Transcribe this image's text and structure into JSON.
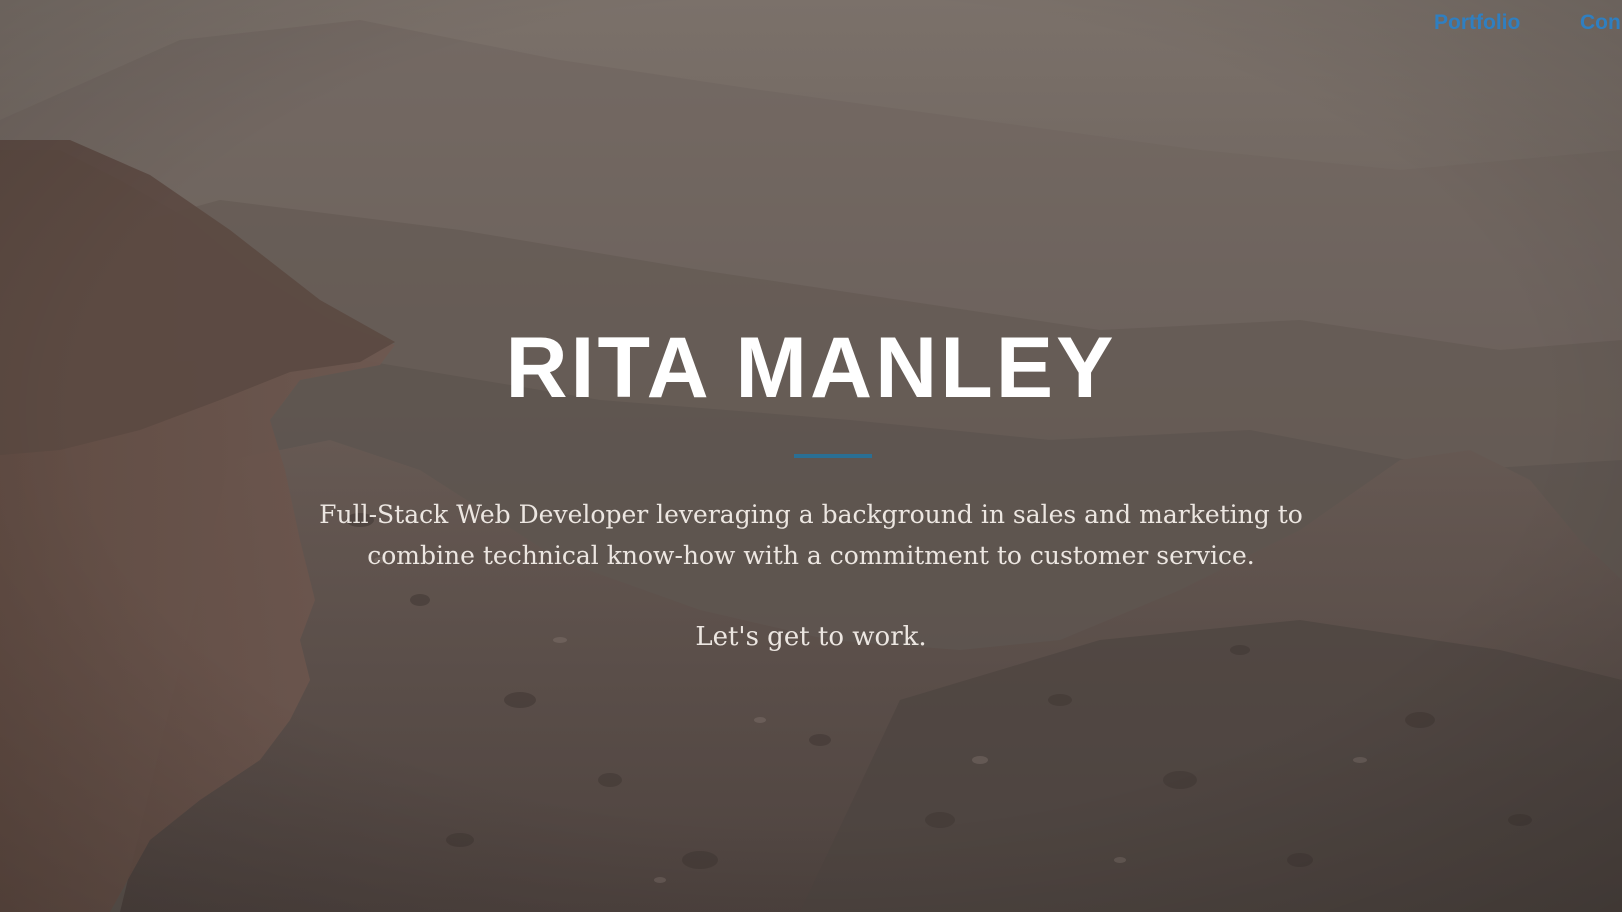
{
  "nav": {
    "items": [
      {
        "label": "Portfolio"
      },
      {
        "label": "Con"
      }
    ]
  },
  "hero": {
    "name": "RITA MANLEY",
    "tagline_line1": "Full-Stack Web Developer leveraging a background in sales and marketing to",
    "tagline_line2": "combine technical know-how with a commitment to customer service.",
    "cta": "Let's get to work."
  },
  "colors": {
    "accent": "#2a6f94",
    "nav_link": "#2f7fc1",
    "heading": "#ffffff",
    "body_text": "#ece6e1",
    "overlay": "#5e544d"
  }
}
